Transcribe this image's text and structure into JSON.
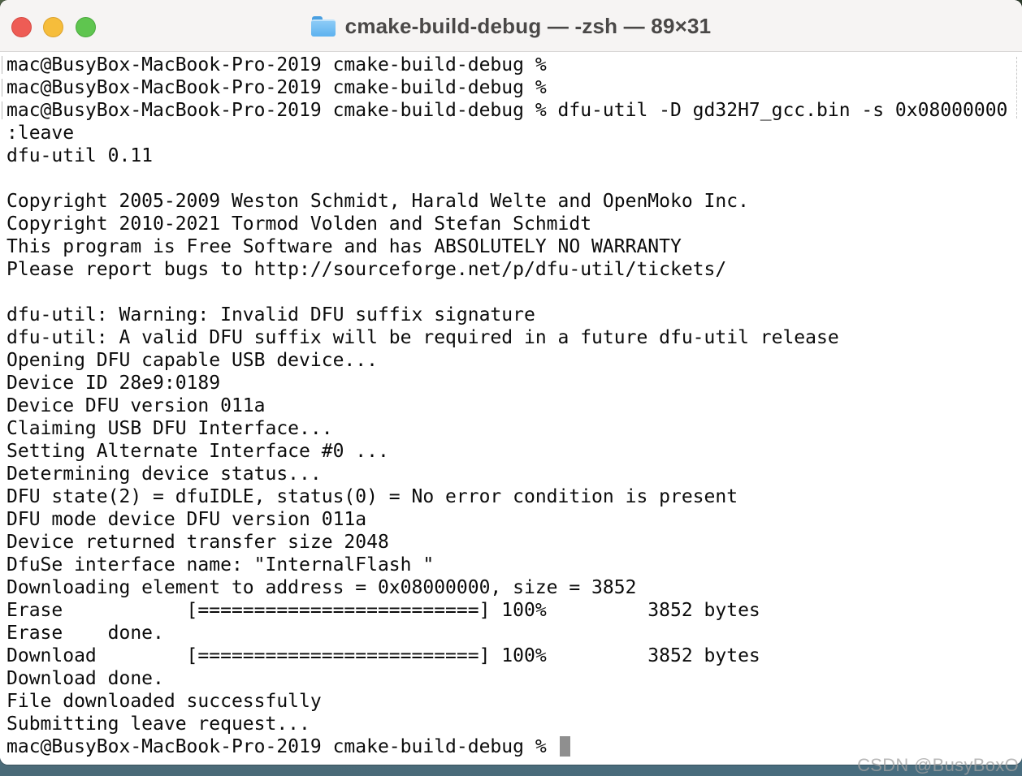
{
  "window": {
    "title": "cmake-build-debug — -zsh — 89×31",
    "folder_icon": "folder-icon",
    "traffic_lights": {
      "close": "#ee5c55",
      "minimize": "#f6bd3b",
      "zoom": "#5fc54f"
    }
  },
  "terminal": {
    "lines": [
      {
        "text": "mac@BusyBox-MacBook-Pro-2019 cmake-build-debug %",
        "marked": true
      },
      {
        "text": "mac@BusyBox-MacBook-Pro-2019 cmake-build-debug %",
        "marked": true
      },
      {
        "text": "mac@BusyBox-MacBook-Pro-2019 cmake-build-debug % dfu-util -D gd32H7_gcc.bin -s 0x08000000",
        "marked": true
      },
      {
        "text": ":leave",
        "marked": false
      },
      {
        "text": "dfu-util 0.11",
        "marked": false
      },
      {
        "text": "",
        "marked": false
      },
      {
        "text": "Copyright 2005-2009 Weston Schmidt, Harald Welte and OpenMoko Inc.",
        "marked": false
      },
      {
        "text": "Copyright 2010-2021 Tormod Volden and Stefan Schmidt",
        "marked": false
      },
      {
        "text": "This program is Free Software and has ABSOLUTELY NO WARRANTY",
        "marked": false
      },
      {
        "text": "Please report bugs to http://sourceforge.net/p/dfu-util/tickets/",
        "marked": false
      },
      {
        "text": "",
        "marked": false
      },
      {
        "text": "dfu-util: Warning: Invalid DFU suffix signature",
        "marked": false
      },
      {
        "text": "dfu-util: A valid DFU suffix will be required in a future dfu-util release",
        "marked": false
      },
      {
        "text": "Opening DFU capable USB device...",
        "marked": false
      },
      {
        "text": "Device ID 28e9:0189",
        "marked": false
      },
      {
        "text": "Device DFU version 011a",
        "marked": false
      },
      {
        "text": "Claiming USB DFU Interface...",
        "marked": false
      },
      {
        "text": "Setting Alternate Interface #0 ...",
        "marked": false
      },
      {
        "text": "Determining device status...",
        "marked": false
      },
      {
        "text": "DFU state(2) = dfuIDLE, status(0) = No error condition is present",
        "marked": false
      },
      {
        "text": "DFU mode device DFU version 011a",
        "marked": false
      },
      {
        "text": "Device returned transfer size 2048",
        "marked": false
      },
      {
        "text": "DfuSe interface name: \"InternalFlash \"",
        "marked": false
      },
      {
        "text": "Downloading element to address = 0x08000000, size = 3852",
        "marked": false
      },
      {
        "text": "Erase           [=========================] 100%         3852 bytes",
        "marked": false
      },
      {
        "text": "Erase    done.",
        "marked": false
      },
      {
        "text": "Download        [=========================] 100%         3852 bytes",
        "marked": false
      },
      {
        "text": "Download done.",
        "marked": false
      },
      {
        "text": "File downloaded successfully",
        "marked": false
      },
      {
        "text": "Submitting leave request...",
        "marked": false
      }
    ],
    "prompt": "mac@BusyBox-MacBook-Pro-2019 cmake-build-debug % ",
    "cursor_color": "#8f8f8f"
  },
  "watermark": "CSDN @BusyBoxO"
}
